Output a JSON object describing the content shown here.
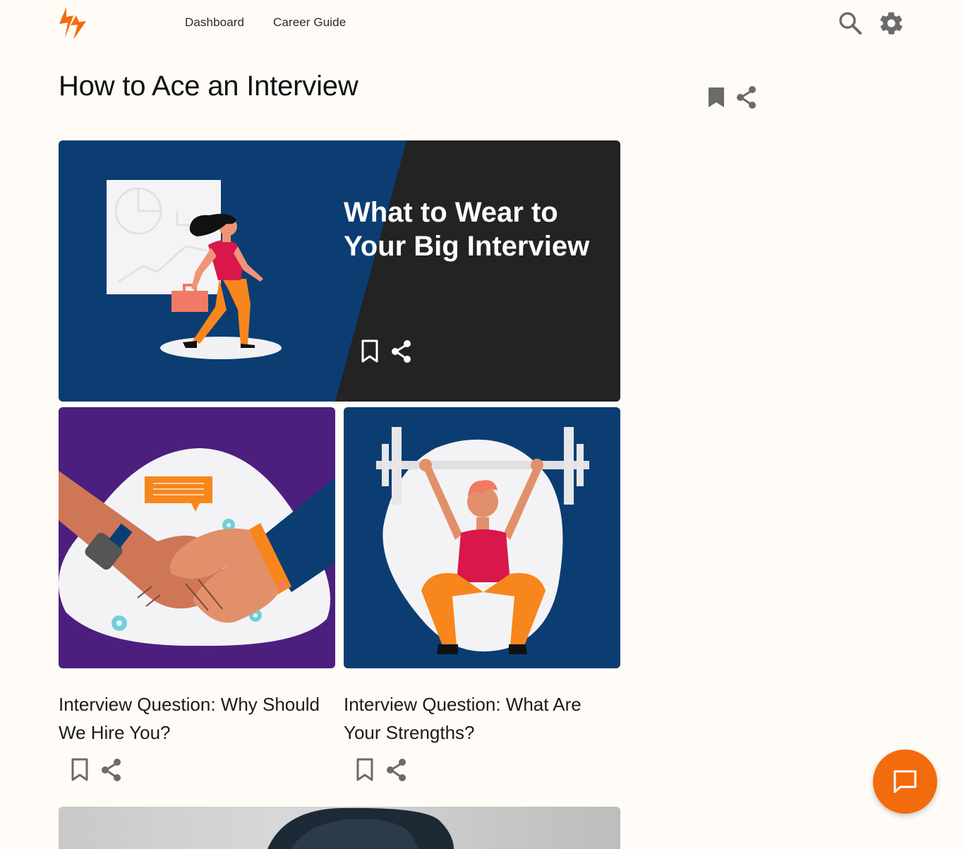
{
  "header": {
    "logo": "lightning-bolt-logo",
    "nav": [
      {
        "label": "Dashboard"
      },
      {
        "label": "Career Guide"
      }
    ],
    "icons": [
      "search-icon",
      "gear-icon"
    ]
  },
  "page": {
    "title": "How to Ace an Interview",
    "actions": [
      "bookmark-icon",
      "share-icon"
    ]
  },
  "featured": {
    "title": "What to Wear to Your Big Interview",
    "colors": {
      "left": "#0b3d73",
      "right": "#232323"
    }
  },
  "cards": [
    {
      "title": "Interview Question: Why Should We Hire You?",
      "background": "#4c1f7f"
    },
    {
      "title": "Interview Question: What Are Your Strengths?",
      "background": "#0b3d73"
    }
  ],
  "chat": {
    "icon": "chat-bubble-icon",
    "color": "#f26b0c"
  }
}
